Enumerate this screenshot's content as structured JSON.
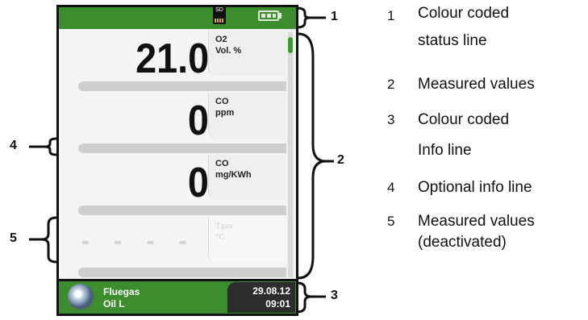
{
  "device": {
    "status_line": {
      "sd_label": "SD",
      "battery_icon": "battery-icon",
      "sd_icon": "sd-card-icon"
    },
    "measurements": [
      {
        "value": "21.0",
        "label_top": "O2",
        "label_bottom": "Vol. %",
        "active": true
      },
      {
        "value": "0",
        "label_top": "CO",
        "label_bottom": "ppm",
        "active": true
      },
      {
        "value": "0",
        "label_top": "CO",
        "label_bottom": "mg/KWh",
        "active": true
      },
      {
        "value": "- - - -",
        "label_top": "Tgas",
        "label_bottom": "°C",
        "active": false
      }
    ],
    "info_line": {
      "icon": "fuel-drop-icon",
      "fuel_label": "Fluegas",
      "fuel_type": "Oil L",
      "date": "29.08.12",
      "time": "09:01"
    },
    "colors": {
      "status_green": "#3b8d2e",
      "scroll_green": "#3aa02c",
      "info_dark": "#2d2d2d"
    }
  },
  "callouts": [
    "1",
    "2",
    "3",
    "4",
    "5"
  ],
  "legend": [
    {
      "num": "1",
      "text_line1": "Colour coded",
      "text_line2": "status line"
    },
    {
      "num": "2",
      "text_line1": "Measured values",
      "text_line2": ""
    },
    {
      "num": "3",
      "text_line1": "Colour coded",
      "text_line2": "Info line"
    },
    {
      "num": "4",
      "text_line1": "Optional info line",
      "text_line2": ""
    },
    {
      "num": "5",
      "text_line1": "Measured values",
      "text_line2": "(deactivated)"
    }
  ]
}
